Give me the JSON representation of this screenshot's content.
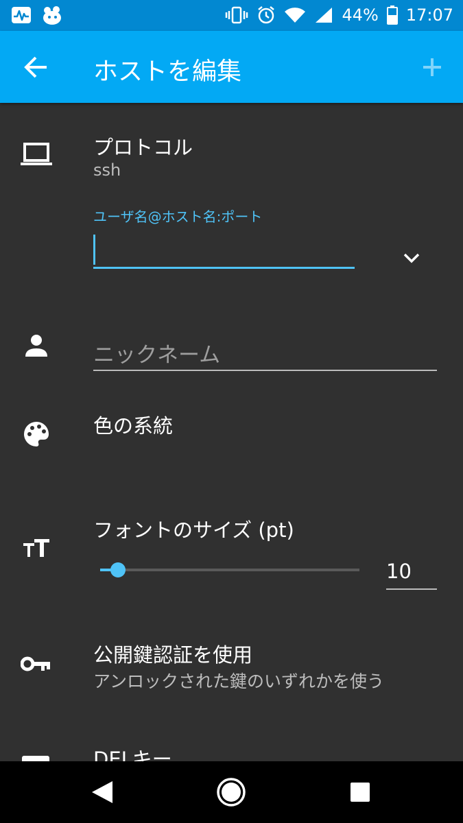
{
  "status_bar": {
    "battery": "44%",
    "time": "17:07"
  },
  "app_bar": {
    "title": "ホストを編集"
  },
  "protocol": {
    "label": "プロトコル",
    "value": "ssh"
  },
  "host_field": {
    "label": "ユーザ名@ホスト名:ポート",
    "value": ""
  },
  "nickname_field": {
    "placeholder": "ニックネーム"
  },
  "color_scheme": {
    "label": "色の系統"
  },
  "font_size": {
    "label": "フォントのサイズ (pt)",
    "value": "10",
    "slider_fraction": 0.06
  },
  "pubkey": {
    "label": "公開鍵認証を使用",
    "summary": "アンロックされた鍵のいずれかを使う"
  },
  "del_key": {
    "label": "DELキー"
  },
  "colors": {
    "accent": "#4fc3f7",
    "app_bar": "#03a9f4",
    "status_bar": "#0288d1",
    "background": "#303030"
  }
}
